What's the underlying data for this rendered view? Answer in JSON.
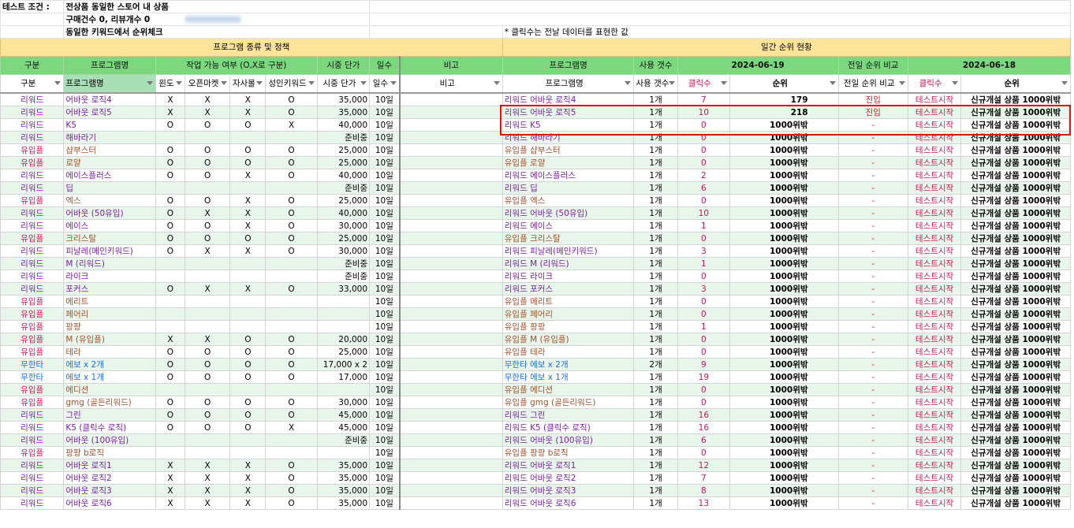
{
  "info": {
    "label": "테스트 조건 :",
    "line1": "전상품 동일한 스토어 내 상품",
    "line2": "구매건수 0, 리뷰개수 0",
    "line3": "동일한 키워드에서 순위체크",
    "note": "* 클릭수는 전날 데이터를 표현한 값"
  },
  "sections": {
    "left": "프로그램 종류 및 정책",
    "right": "일간 순위 현황"
  },
  "header1": {
    "category": "구분",
    "program": "프로그램명",
    "work": "작업 가능 여부 (O,X로 구분)",
    "price": "시중 단가",
    "days": "일수",
    "note": "비고",
    "program2": "프로그램명",
    "usage": "사용 갯수",
    "date1": "2024-06-19",
    "compare": "전일 순위 비교",
    "date2": "2024-06-18"
  },
  "header2": {
    "category": "구분",
    "program": "프로그램명",
    "windo": "윈도",
    "openmarket": "오픈마켓",
    "self": "자사몰",
    "adult": "성인키워드",
    "price": "시중 단가",
    "days": "일수",
    "note": "비고",
    "program2": "프로그램명",
    "usage": "사용 갯수",
    "clicks": "클릭수",
    "rank": "순위",
    "compare": "전일 순위 비교",
    "clicks2": "클릭수",
    "rank2": "순위"
  },
  "rows": [
    {
      "cat": "리워드",
      "name": "어바웃 로직4",
      "w": "X",
      "o": "X",
      "s": "X",
      "a": "O",
      "price": "35,000",
      "days": "10일",
      "prog": "리워드 어바웃 로직4",
      "usage": "1개",
      "clicks": "7",
      "rank": "179",
      "cmp": "진입",
      "clicks2": "테스트시작",
      "rank2": "신규개설 상품 1000위밖"
    },
    {
      "cat": "리워드",
      "name": "어바웃 로직5",
      "w": "X",
      "o": "X",
      "s": "X",
      "a": "O",
      "price": "35,000",
      "days": "10일",
      "prog": "리워드 어바웃 로직5",
      "usage": "1개",
      "clicks": "10",
      "rank": "218",
      "cmp": "진입",
      "clicks2": "테스트시작",
      "rank2": "신규개설 상품 1000위밖"
    },
    {
      "cat": "리워드",
      "name": "K5",
      "w": "O",
      "o": "O",
      "s": "O",
      "a": "X",
      "price": "40,000",
      "days": "10일",
      "prog": "리워드 K5",
      "usage": "1개",
      "clicks": "0",
      "rank": "1000위밖",
      "cmp": "-",
      "clicks2": "테스트시작",
      "rank2": "신규개설 상품 1000위밖"
    },
    {
      "cat": "리워드",
      "name": "해바라기",
      "w": "",
      "o": "",
      "s": "",
      "a": "",
      "price": "준비중",
      "days": "10일",
      "prog": "리워드 해바라기",
      "usage": "1개",
      "clicks": "0",
      "rank": "1000위밖",
      "cmp": "-",
      "clicks2": "테스트시작",
      "rank2": "신규개설 상품 1000위밖"
    },
    {
      "cat": "유입플",
      "name": "샵부스터",
      "w": "O",
      "o": "O",
      "s": "O",
      "a": "O",
      "price": "25,000",
      "days": "10일",
      "prog": "유입플 샵부스터",
      "usage": "1개",
      "clicks": "0",
      "rank": "1000위밖",
      "cmp": "-",
      "clicks2": "테스트시작",
      "rank2": "신규개설 상품 1000위밖"
    },
    {
      "cat": "유입플",
      "name": "로얄",
      "w": "O",
      "o": "O",
      "s": "O",
      "a": "O",
      "price": "25,000",
      "days": "10일",
      "prog": "유입플 로얄",
      "usage": "1개",
      "clicks": "0",
      "rank": "1000위밖",
      "cmp": "-",
      "clicks2": "테스트시작",
      "rank2": "신규개설 상품 1000위밖"
    },
    {
      "cat": "리워드",
      "name": "에이스플러스",
      "w": "O",
      "o": "O",
      "s": "X",
      "a": "O",
      "price": "40,000",
      "days": "10일",
      "prog": "리워드 에이스플러스",
      "usage": "1개",
      "clicks": "2",
      "rank": "1000위밖",
      "cmp": "-",
      "clicks2": "테스트시작",
      "rank2": "신규개설 상품 1000위밖"
    },
    {
      "cat": "리워드",
      "name": "딥",
      "w": "",
      "o": "",
      "s": "",
      "a": "",
      "price": "준비중",
      "days": "10일",
      "prog": "리워드 딥",
      "usage": "1개",
      "clicks": "6",
      "rank": "1000위밖",
      "cmp": "-",
      "clicks2": "테스트시작",
      "rank2": "신규개설 상품 1000위밖"
    },
    {
      "cat": "유입플",
      "name": "엑스",
      "w": "O",
      "o": "O",
      "s": "X",
      "a": "O",
      "price": "25,000",
      "days": "10일",
      "prog": "유입플 엑스",
      "usage": "1개",
      "clicks": "0",
      "rank": "1000위밖",
      "cmp": "-",
      "clicks2": "테스트시작",
      "rank2": "신규개설 상품 1000위밖"
    },
    {
      "cat": "리워드",
      "name": "어바웃 (50유입)",
      "w": "O",
      "o": "X",
      "s": "X",
      "a": "O",
      "price": "40,000",
      "days": "10일",
      "prog": "리워드 어바웃 (50유입)",
      "usage": "1개",
      "clicks": "10",
      "rank": "1000위밖",
      "cmp": "-",
      "clicks2": "테스트시작",
      "rank2": "신규개설 상품 1000위밖"
    },
    {
      "cat": "리워드",
      "name": "에이스",
      "w": "O",
      "o": "O",
      "s": "X",
      "a": "O",
      "price": "30,000",
      "days": "10일",
      "prog": "리워드 에이스",
      "usage": "1개",
      "clicks": "1",
      "rank": "1000위밖",
      "cmp": "-",
      "clicks2": "테스트시작",
      "rank2": "신규개설 상품 1000위밖"
    },
    {
      "cat": "유입플",
      "name": "크리스탈",
      "w": "O",
      "o": "O",
      "s": "O",
      "a": "O",
      "price": "25,000",
      "days": "10일",
      "prog": "유입플 크리스탈",
      "usage": "1개",
      "clicks": "0",
      "rank": "1000위밖",
      "cmp": "-",
      "clicks2": "테스트시작",
      "rank2": "신규개설 상품 1000위밖"
    },
    {
      "cat": "리워드",
      "name": "피날레(메인키워드)",
      "w": "O",
      "o": "X",
      "s": "X",
      "a": "O",
      "price": "30,000",
      "days": "10일",
      "prog": "리워드 피날레(메인키워드)",
      "usage": "1개",
      "clicks": "3",
      "rank": "1000위밖",
      "cmp": "-",
      "clicks2": "테스트시작",
      "rank2": "신규개설 상품 1000위밖"
    },
    {
      "cat": "리워드",
      "name": "M (리워드)",
      "w": "",
      "o": "",
      "s": "",
      "a": "",
      "price": "준비중",
      "days": "10일",
      "prog": "리워드 M (리워드)",
      "usage": "1개",
      "clicks": "1",
      "rank": "1000위밖",
      "cmp": "-",
      "clicks2": "테스트시작",
      "rank2": "신규개설 상품 1000위밖"
    },
    {
      "cat": "리워드",
      "name": "라이크",
      "w": "",
      "o": "",
      "s": "",
      "a": "",
      "price": "준비중",
      "days": "10일",
      "prog": "리워드 라이크",
      "usage": "1개",
      "clicks": "0",
      "rank": "1000위밖",
      "cmp": "-",
      "clicks2": "테스트시작",
      "rank2": "신규개설 상품 1000위밖"
    },
    {
      "cat": "리워드",
      "name": "포커스",
      "w": "O",
      "o": "X",
      "s": "X",
      "a": "O",
      "price": "33,000",
      "days": "10일",
      "prog": "리워드 포커스",
      "usage": "1개",
      "clicks": "3",
      "rank": "1000위밖",
      "cmp": "-",
      "clicks2": "테스트시작",
      "rank2": "신규개설 상품 1000위밖"
    },
    {
      "cat": "유입플",
      "name": "메리트",
      "w": "",
      "o": "",
      "s": "",
      "a": "",
      "price": "",
      "days": "10일",
      "prog": "유입플 메리트",
      "usage": "1개",
      "clicks": "0",
      "rank": "1000위밖",
      "cmp": "-",
      "clicks2": "테스트시작",
      "rank2": "신규개설 상품 1000위밖"
    },
    {
      "cat": "유입플",
      "name": "페어리",
      "w": "",
      "o": "",
      "s": "",
      "a": "",
      "price": "",
      "days": "10일",
      "prog": "유입플 페어리",
      "usage": "1개",
      "clicks": "0",
      "rank": "1000위밖",
      "cmp": "-",
      "clicks2": "테스트시작",
      "rank2": "신규개설 상품 1000위밖"
    },
    {
      "cat": "유입플",
      "name": "팡팡",
      "w": "",
      "o": "",
      "s": "",
      "a": "",
      "price": "",
      "days": "10일",
      "prog": "유입플 팡팡",
      "usage": "1개",
      "clicks": "1",
      "rank": "1000위밖",
      "cmp": "-",
      "clicks2": "테스트시작",
      "rank2": "신규개설 상품 1000위밖"
    },
    {
      "cat": "유입플",
      "name": "M (유입플)",
      "w": "X",
      "o": "X",
      "s": "O",
      "a": "O",
      "price": "20,000",
      "days": "10일",
      "prog": "유입플 M (유입플)",
      "usage": "1개",
      "clicks": "0",
      "rank": "1000위밖",
      "cmp": "-",
      "clicks2": "테스트시작",
      "rank2": "신규개설 상품 1000위밖"
    },
    {
      "cat": "유입플",
      "name": "테라",
      "w": "O",
      "o": "O",
      "s": "O",
      "a": "O",
      "price": "25,000",
      "days": "10일",
      "prog": "유입플 테라",
      "usage": "1개",
      "clicks": "0",
      "rank": "1000위밖",
      "cmp": "-",
      "clicks2": "테스트시작",
      "rank2": "신규개설 상품 1000위밖"
    },
    {
      "cat": "무한타",
      "name": "에보 x 2개",
      "w": "O",
      "o": "O",
      "s": "O",
      "a": "O",
      "price": "17,000 x 2",
      "days": "10일",
      "prog": "무한타 에보 x 2개",
      "usage": "2개",
      "clicks": "9",
      "rank": "1000위밖",
      "cmp": "-",
      "clicks2": "테스트시작",
      "rank2": "신규개설 상품 1000위밖"
    },
    {
      "cat": "무한타",
      "name": "에보 x 1개",
      "w": "O",
      "o": "O",
      "s": "O",
      "a": "O",
      "price": "17,000",
      "days": "10일",
      "prog": "무한타 에보 x 1개",
      "usage": "1개",
      "clicks": "19",
      "rank": "1000위밖",
      "cmp": "-",
      "clicks2": "테스트시작",
      "rank2": "신규개설 상품 1000위밖"
    },
    {
      "cat": "유입플",
      "name": "에디션",
      "w": "",
      "o": "",
      "s": "",
      "a": "",
      "price": "",
      "days": "10일",
      "prog": "유입플 에디션",
      "usage": "1개",
      "clicks": "0",
      "rank": "1000위밖",
      "cmp": "-",
      "clicks2": "테스트시작",
      "rank2": "신규개설 상품 1000위밖"
    },
    {
      "cat": "유입플",
      "name": "gmg (골든리워드)",
      "w": "O",
      "o": "O",
      "s": "O",
      "a": "O",
      "price": "30,000",
      "days": "10일",
      "prog": "유입플 gmg (골든리워드)",
      "usage": "1개",
      "clicks": "0",
      "rank": "1000위밖",
      "cmp": "-",
      "clicks2": "테스트시작",
      "rank2": "신규개설 상품 1000위밖"
    },
    {
      "cat": "리워드",
      "name": "그린",
      "w": "O",
      "o": "O",
      "s": "O",
      "a": "O",
      "price": "45,000",
      "days": "10일",
      "prog": "리워드 그린",
      "usage": "1개",
      "clicks": "16",
      "rank": "1000위밖",
      "cmp": "-",
      "clicks2": "테스트시작",
      "rank2": "신규개설 상품 1000위밖"
    },
    {
      "cat": "리워드",
      "name": "K5 (클릭수 로직)",
      "w": "O",
      "o": "O",
      "s": "O",
      "a": "X",
      "price": "45,000",
      "days": "10일",
      "prog": "리워드 K5 (클릭수 로직)",
      "usage": "1개",
      "clicks": "16",
      "rank": "1000위밖",
      "cmp": "-",
      "clicks2": "테스트시작",
      "rank2": "신규개설 상품 1000위밖"
    },
    {
      "cat": "리워드",
      "name": "어바웃 (100유입)",
      "w": "",
      "o": "",
      "s": "",
      "a": "",
      "price": "준비중",
      "days": "10일",
      "prog": "리워드 어바웃 (100유입)",
      "usage": "1개",
      "clicks": "6",
      "rank": "1000위밖",
      "cmp": "-",
      "clicks2": "테스트시작",
      "rank2": "신규개설 상품 1000위밖"
    },
    {
      "cat": "유입플",
      "name": "팡팡 b로직",
      "w": "",
      "o": "",
      "s": "",
      "a": "",
      "price": "",
      "days": "10일",
      "prog": "유입플 팡팡 b로직",
      "usage": "1개",
      "clicks": "0",
      "rank": "1000위밖",
      "cmp": "-",
      "clicks2": "테스트시작",
      "rank2": "신규개설 상품 1000위밖"
    },
    {
      "cat": "리워드",
      "name": "어바웃 로직1",
      "w": "X",
      "o": "X",
      "s": "X",
      "a": "O",
      "price": "35,000",
      "days": "10일",
      "prog": "리워드 어바웃 로직1",
      "usage": "1개",
      "clicks": "12",
      "rank": "1000위밖",
      "cmp": "-",
      "clicks2": "테스트시작",
      "rank2": "신규개설 상품 1000위밖"
    },
    {
      "cat": "리워드",
      "name": "어바웃 로직2",
      "w": "X",
      "o": "X",
      "s": "X",
      "a": "O",
      "price": "35,000",
      "days": "10일",
      "prog": "리워드 어바웃 로직2",
      "usage": "1개",
      "clicks": "7",
      "rank": "1000위밖",
      "cmp": "-",
      "clicks2": "테스트시작",
      "rank2": "신규개설 상품 1000위밖"
    },
    {
      "cat": "리워드",
      "name": "어바웃 로직3",
      "w": "X",
      "o": "X",
      "s": "X",
      "a": "O",
      "price": "35,000",
      "days": "10일",
      "prog": "리워드 어바웃 로직3",
      "usage": "1개",
      "clicks": "8",
      "rank": "1000위밖",
      "cmp": "-",
      "clicks2": "테스트시작",
      "rank2": "신규개설 상품 1000위밖"
    },
    {
      "cat": "리워드",
      "name": "어바웃 로직6",
      "w": "X",
      "o": "X",
      "s": "X",
      "a": "O",
      "price": "35,000",
      "days": "10일",
      "prog": "리워드 어바웃 로직6",
      "usage": "1개",
      "clicks": "13",
      "rank": "1000위밖",
      "cmp": "-",
      "clicks2": "테스트시작",
      "rank2": "신규개설 상품 1000위밖"
    }
  ],
  "colors": {
    "header_green": "#7ed67f",
    "section_yellow": "#fce49a",
    "highlight_red": "#e01010",
    "row_stripe": "#e8f5ea"
  }
}
